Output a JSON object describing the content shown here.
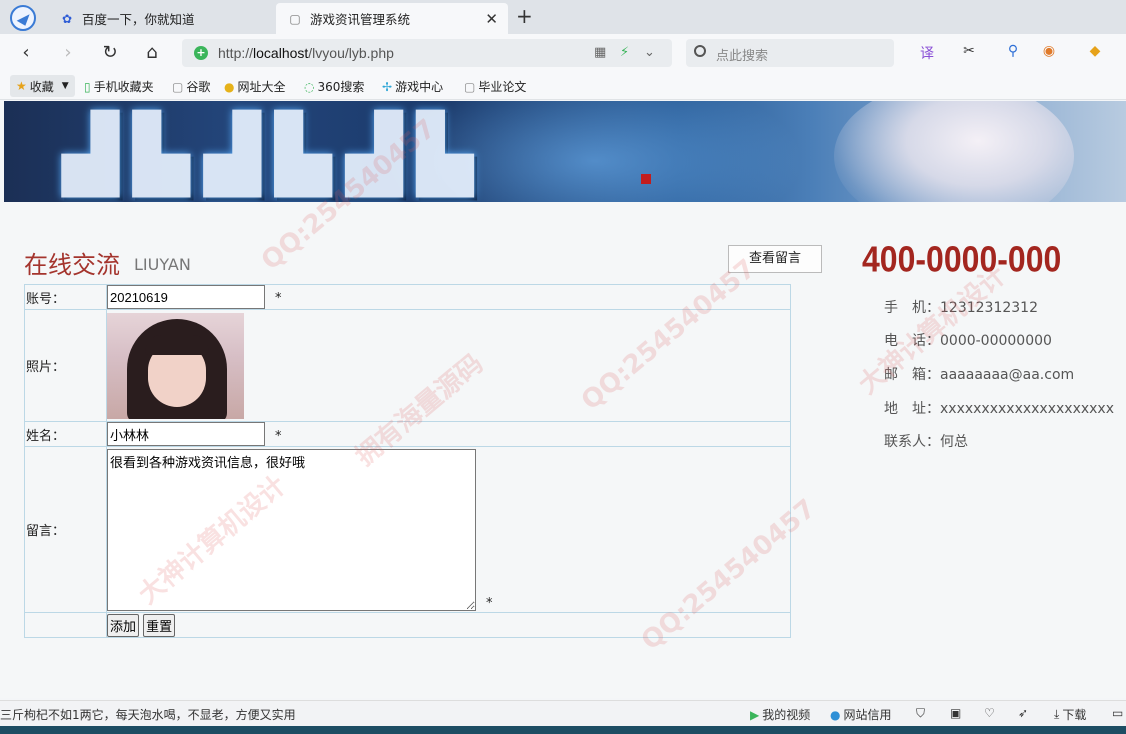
{
  "browser": {
    "tabs": [
      {
        "label": "百度一下，你就知道",
        "icon": "baidu-paw-icon"
      },
      {
        "label": "游戏资讯管理系统",
        "icon": "document-icon",
        "active": true
      }
    ],
    "url_prefix": "http://",
    "url_host": "localhost",
    "url_path": "/lvyou/lyb.php",
    "search_placeholder": "点此搜索",
    "bookmarks": [
      "收藏",
      "手机收藏夹",
      "谷歌",
      "网址大全",
      "360搜索",
      "游戏中心",
      "毕业论文"
    ]
  },
  "page": {
    "section_title": "在线交流",
    "section_sub": "LIUYAN",
    "view_button": "查看留言",
    "form": {
      "account_label": "账号：",
      "account_value": "20210619",
      "photo_label": "照片：",
      "name_label": "姓名：",
      "name_value": "小林林",
      "message_label": "留言：",
      "message_value": "很看到各种游戏资讯信息，很好哦",
      "required_mark": "*",
      "add_button": "添加",
      "reset_button": "重置"
    },
    "contact": {
      "hotline": "400-0000-000",
      "mobile_label": "手　机：",
      "mobile": "12312312312",
      "phone_label": "电　话：",
      "phone": "0000-00000000",
      "email_label": "邮　箱：",
      "email": "aaaaaaaa@aa.com",
      "address_label": "地　址：",
      "address": "xxxxxxxxxxxxxxxxxxxxx",
      "contact_label": "联系人：",
      "contact_person": "何总"
    }
  },
  "statusbar": {
    "ad_text": "三斤枸杞不如1两它，每天泡水喝，不显老，方便又实用",
    "items": [
      "我的视频",
      "网站信用",
      "下载"
    ]
  },
  "watermarks": [
    "QQ:254540457",
    "拥有海量源码",
    "大神计算机设计"
  ],
  "colors": {
    "accent_red": "#a4342d",
    "table_border": "#bcd8e6"
  }
}
